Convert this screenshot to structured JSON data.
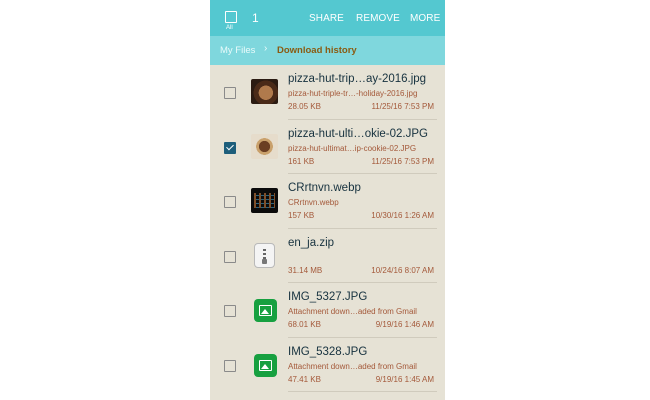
{
  "header": {
    "all_label": "All",
    "selected_count": "1",
    "actions": {
      "share": "SHARE",
      "remove": "REMOVE",
      "more": "MORE"
    }
  },
  "breadcrumb": {
    "root": "My Files",
    "separator": "›",
    "current": "Download history"
  },
  "files": [
    {
      "name": "pizza-hut-trip…ay-2016.jpg",
      "subtitle": "pizza-hut-triple-tr…-holiday-2016.jpg",
      "size": "28.05 KB",
      "date": "11/25/16 7:53 PM",
      "checked": false,
      "icon": "pizza-thumbnail"
    },
    {
      "name": "pizza-hut-ulti…okie-02.JPG",
      "subtitle": "pizza-hut-ultimat…ip-cookie-02.JPG",
      "size": "161 KB",
      "date": "11/25/16 7:53 PM",
      "checked": true,
      "icon": "cookie-thumbnail"
    },
    {
      "name": "CRrtnvn.webp",
      "subtitle": "CRrtnvn.webp",
      "size": "157 KB",
      "date": "10/30/16 1:26 AM",
      "checked": false,
      "icon": "image-thumbnail"
    },
    {
      "name": "en_ja.zip",
      "subtitle": "",
      "size": "31.14 MB",
      "date": "10/24/16 8:07 AM",
      "checked": false,
      "icon": "zip-icon"
    },
    {
      "name": "IMG_5327.JPG",
      "subtitle": "Attachment down…aded from Gmail",
      "size": "68.01 KB",
      "date": "9/19/16 1:46 AM",
      "checked": false,
      "icon": "gallery-icon"
    },
    {
      "name": "IMG_5328.JPG",
      "subtitle": "Attachment down…aded from Gmail",
      "size": "47.41 KB",
      "date": "9/19/16 1:45 AM",
      "checked": false,
      "icon": "gallery-icon"
    }
  ],
  "colors": {
    "action_bar": "#54c8d0",
    "breadcrumb_bar": "#7fd7dd",
    "list_background": "#e6e2d5",
    "checkbox_checked": "#1d5e7b",
    "meta_text": "#a4593a",
    "gallery_icon": "#17a040"
  }
}
